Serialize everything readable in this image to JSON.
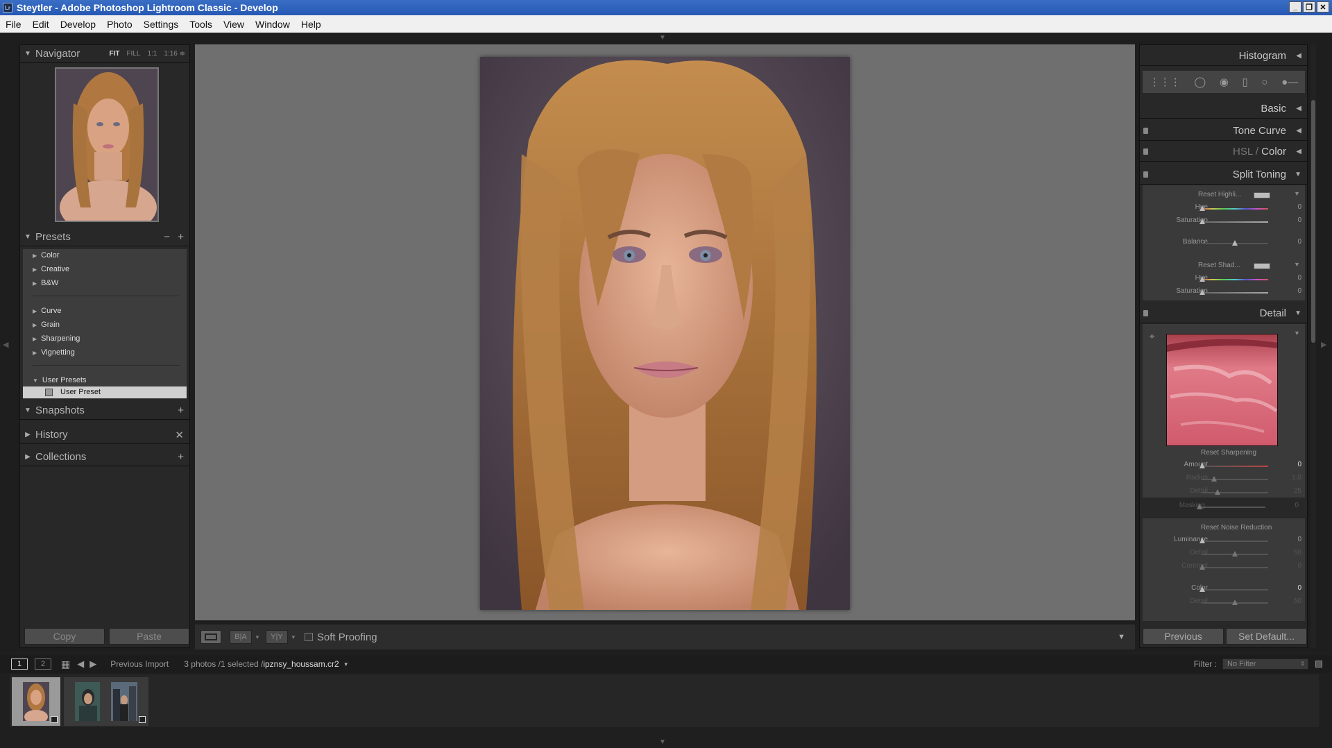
{
  "window": {
    "title": "Steytler - Adobe Photoshop Lightroom Classic - Develop",
    "logo": "Lr"
  },
  "menu": [
    "File",
    "Edit",
    "Develop",
    "Photo",
    "Settings",
    "Tools",
    "View",
    "Window",
    "Help"
  ],
  "left": {
    "navigator": {
      "title": "Navigator",
      "modes": [
        "FIT",
        "FILL",
        "1:1",
        "1:16 ≑"
      ]
    },
    "presets": {
      "title": "Presets",
      "groups": [
        "Color",
        "Creative",
        "B&W",
        "Curve",
        "Grain",
        "Sharpening",
        "Vignetting",
        "User Presets"
      ],
      "selected": "User Preset"
    },
    "snapshots": "Snapshots",
    "history": "History",
    "collections": "Collections",
    "copy": "Copy",
    "paste": "Paste"
  },
  "toolbar": {
    "soft_proofing": "Soft Proofing",
    "ba": "B|A",
    "yy": "Y|Y"
  },
  "right": {
    "histogram": "Histogram",
    "basic": "Basic",
    "tone_curve": "Tone Curve",
    "hsl": "HSL",
    "slash": " / ",
    "color": "Color",
    "split_toning": "Split Toning",
    "reset_highlights": "Reset Highli...",
    "reset_shadows": "Reset Shad...",
    "hue": "Hue",
    "saturation": "Saturation",
    "balance": "Balance",
    "zero": "0",
    "detail": "Detail",
    "reset_sharpening": "Reset Sharpening",
    "sharpening": [
      {
        "label": "Amount",
        "value": "0"
      },
      {
        "label": "Radius",
        "value": "1.0"
      },
      {
        "label": "Detail",
        "value": "25"
      },
      {
        "label": "Masking",
        "value": "0"
      }
    ],
    "reset_noise": "Reset Noise Reduction",
    "noise": [
      {
        "label": "Luminance",
        "value": "0"
      },
      {
        "label": "Detail",
        "value": "50"
      },
      {
        "label": "Contrast",
        "value": "0"
      },
      {
        "label": "Color",
        "value": "0"
      },
      {
        "label": "Detail",
        "value": "50"
      }
    ],
    "previous": "Previous",
    "set_default": "Set Default..."
  },
  "filmstrip": {
    "page1": "1",
    "page2": "2",
    "source": "Previous Import",
    "count": "3 photos /1 selected /",
    "filename": "ipznsy_houssam.cr2",
    "filter_label": "Filter :",
    "filter_value": "No Filter"
  }
}
